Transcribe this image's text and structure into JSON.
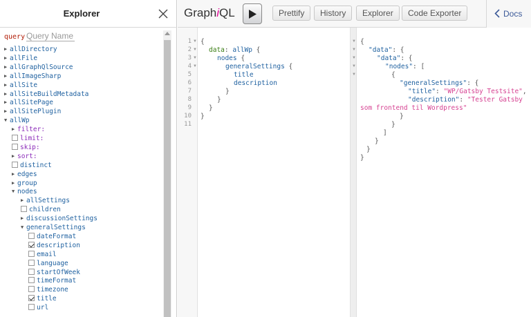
{
  "explorer": {
    "title": "Explorer",
    "close_icon": "close-icon",
    "query_keyword": "query",
    "query_name_placeholder": "Query Name"
  },
  "tree": [
    {
      "label": "allDirectory",
      "kind": "field",
      "control": "arrow-right",
      "level": 0
    },
    {
      "label": "allFile",
      "kind": "field",
      "control": "arrow-right",
      "level": 0
    },
    {
      "label": "allGraphQlSource",
      "kind": "field",
      "control": "arrow-right",
      "level": 0
    },
    {
      "label": "allImageSharp",
      "kind": "field",
      "control": "arrow-right",
      "level": 0
    },
    {
      "label": "allSite",
      "kind": "field",
      "control": "arrow-right",
      "level": 0
    },
    {
      "label": "allSiteBuildMetadata",
      "kind": "field",
      "control": "arrow-right",
      "level": 0
    },
    {
      "label": "allSitePage",
      "kind": "field",
      "control": "arrow-right",
      "level": 0
    },
    {
      "label": "allSitePlugin",
      "kind": "field",
      "control": "arrow-right",
      "level": 0
    },
    {
      "label": "allWp",
      "kind": "field",
      "control": "arrow-down",
      "level": 0
    },
    {
      "label": "filter:",
      "kind": "arg",
      "control": "arrow-right",
      "level": 1
    },
    {
      "label": "limit:",
      "kind": "arg",
      "control": "checkbox",
      "checked": false,
      "level": 1
    },
    {
      "label": "skip:",
      "kind": "arg",
      "control": "checkbox",
      "checked": false,
      "level": 1
    },
    {
      "label": "sort:",
      "kind": "arg",
      "control": "arrow-right",
      "level": 1
    },
    {
      "label": "distinct",
      "kind": "field",
      "control": "checkbox",
      "checked": false,
      "level": 1
    },
    {
      "label": "edges",
      "kind": "field",
      "control": "arrow-right",
      "level": 1
    },
    {
      "label": "group",
      "kind": "field",
      "control": "arrow-right",
      "level": 1
    },
    {
      "label": "nodes",
      "kind": "field",
      "control": "arrow-down",
      "level": 1
    },
    {
      "label": "allSettings",
      "kind": "field",
      "control": "arrow-right",
      "level": 2
    },
    {
      "label": "children",
      "kind": "field",
      "control": "checkbox",
      "checked": false,
      "level": 2
    },
    {
      "label": "discussionSettings",
      "kind": "field",
      "control": "arrow-right",
      "level": 2
    },
    {
      "label": "generalSettings",
      "kind": "field",
      "control": "arrow-down",
      "level": 2
    },
    {
      "label": "dateFormat",
      "kind": "field",
      "control": "checkbox",
      "checked": false,
      "level": 3
    },
    {
      "label": "description",
      "kind": "field",
      "control": "checkbox",
      "checked": true,
      "level": 3
    },
    {
      "label": "email",
      "kind": "field",
      "control": "checkbox",
      "checked": false,
      "level": 3
    },
    {
      "label": "language",
      "kind": "field",
      "control": "checkbox",
      "checked": false,
      "level": 3
    },
    {
      "label": "startOfWeek",
      "kind": "field",
      "control": "checkbox",
      "checked": false,
      "level": 3
    },
    {
      "label": "timeFormat",
      "kind": "field",
      "control": "checkbox",
      "checked": false,
      "level": 3
    },
    {
      "label": "timezone",
      "kind": "field",
      "control": "checkbox",
      "checked": false,
      "level": 3
    },
    {
      "label": "title",
      "kind": "field",
      "control": "checkbox",
      "checked": true,
      "level": 3
    },
    {
      "label": "url",
      "kind": "field",
      "control": "checkbox",
      "checked": false,
      "level": 3
    }
  ],
  "toolbar": {
    "logo_prefix": "Graph",
    "logo_italic": "i",
    "logo_suffix": "QL",
    "run_icon": "play-icon",
    "prettify": "Prettify",
    "history": "History",
    "explorer": "Explorer",
    "code_exporter": "Code Exporter",
    "docs": "Docs",
    "docs_icon": "chevron-left-icon"
  },
  "editor": {
    "line_numbers": [
      "1",
      "2",
      "3",
      "4",
      "5",
      "6",
      "7",
      "8",
      "9",
      "10",
      "11"
    ],
    "line1": "{",
    "line2_key": "data",
    "line2_colon": ": ",
    "line2_field": "allWp",
    "line2_brace": " {",
    "line3_field": "nodes",
    "line3_brace": " {",
    "line4_field": "generalSettings",
    "line4_brace": " {",
    "line5_field": "title",
    "line6_field": "description",
    "line7": "}",
    "line8": "}",
    "line9": "}",
    "line10": "}"
  },
  "result": {
    "open": "{",
    "data_key": "\"data\"",
    "data_open": ": {",
    "data2_key": "\"data\"",
    "data2_open": ": {",
    "nodes_key": "\"nodes\"",
    "nodes_open": ": [",
    "item_open": "{",
    "gs_key": "\"generalSettings\"",
    "gs_open": ": {",
    "title_key": "\"title\"",
    "title_sep": ": ",
    "title_value": "\"WP/Gatsby Testsite\"",
    "title_comma": ",",
    "desc_key": "\"description\"",
    "desc_sep": ": ",
    "desc_value_a": "\"Tester Gatsby",
    "desc_value_b": "som frontend til Wordpress\"",
    "close1": "}",
    "close2": "}",
    "close3": "]",
    "close4": "}",
    "close5": "}",
    "close6": "}"
  }
}
